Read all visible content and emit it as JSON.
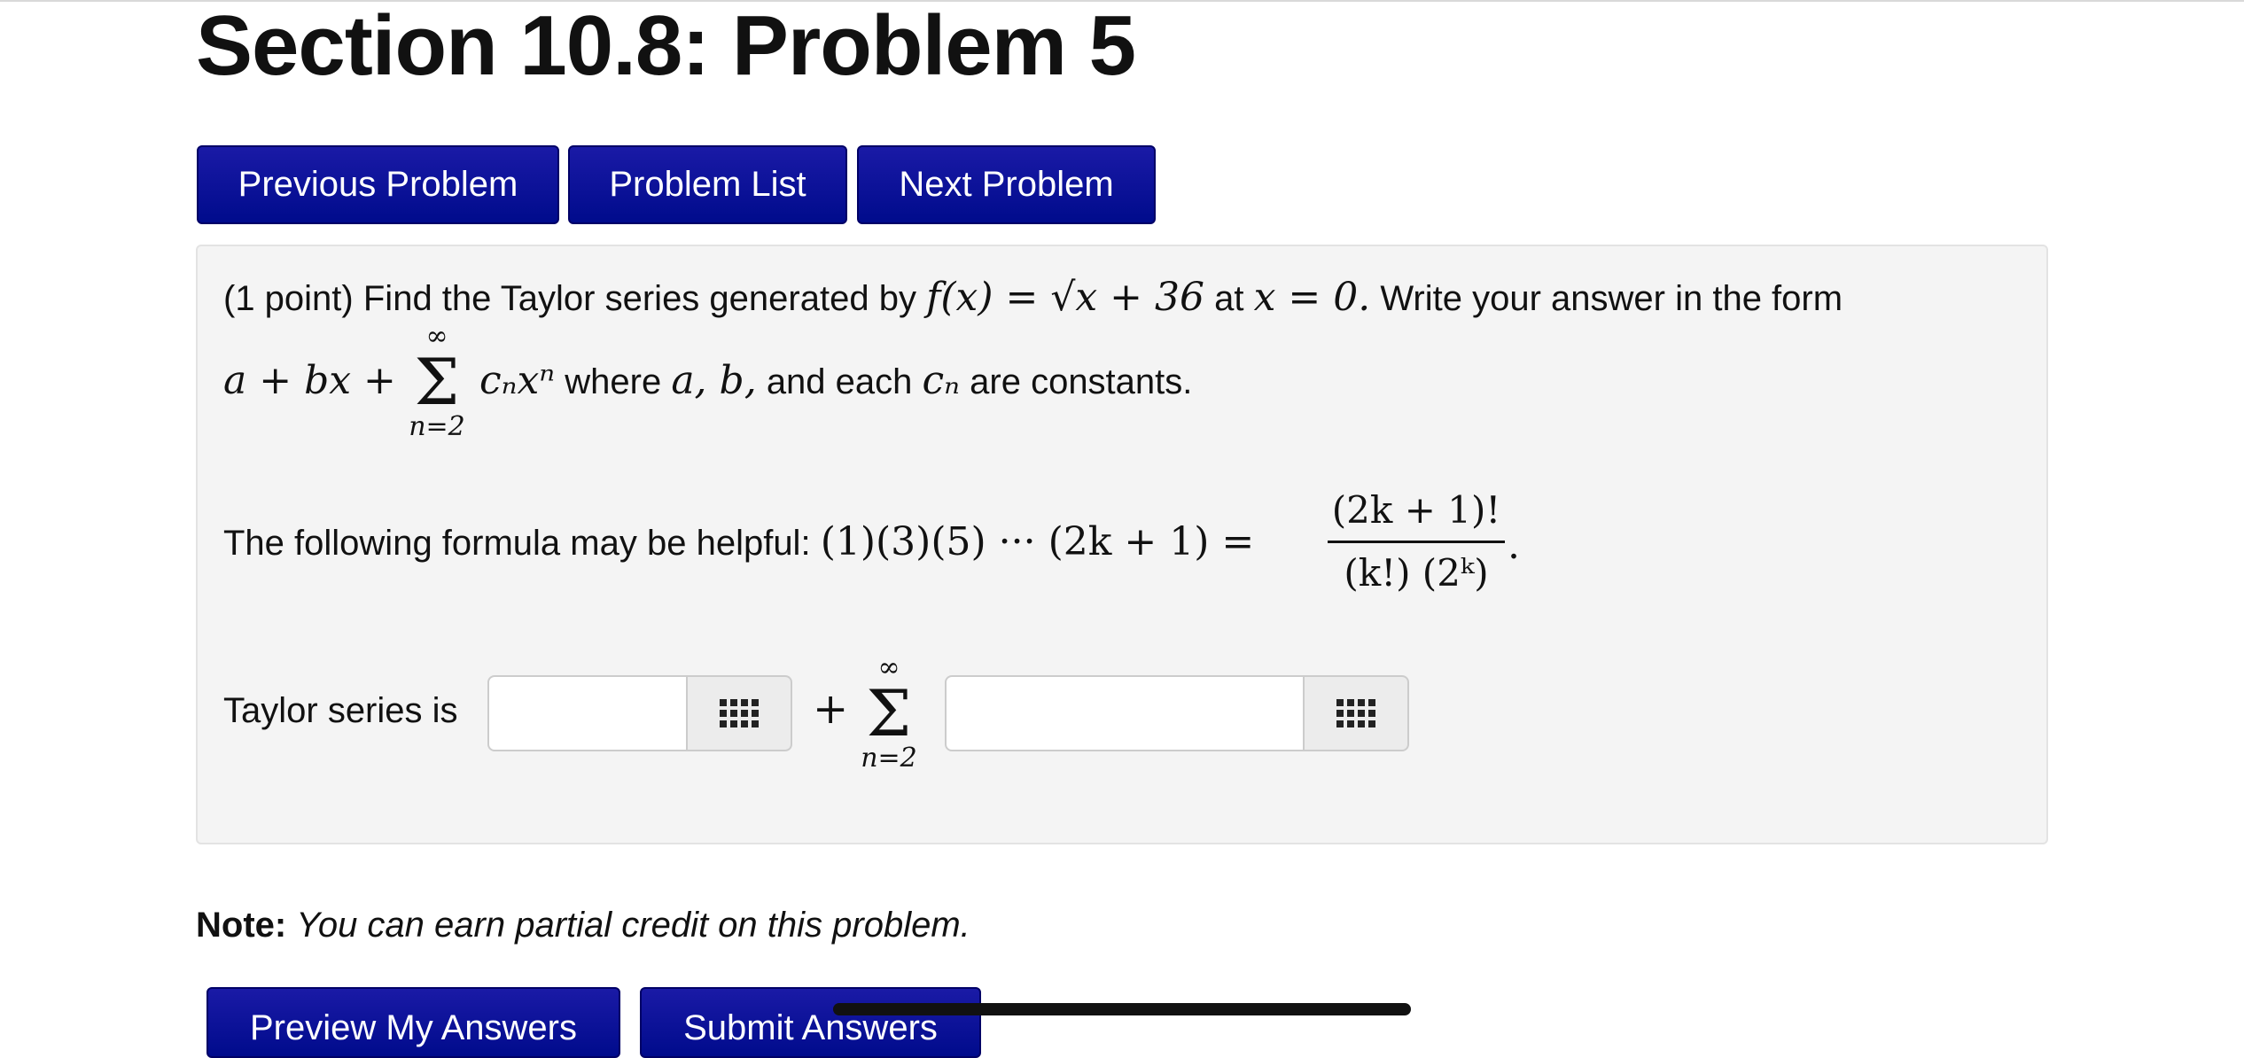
{
  "page": {
    "title": "Section 10.8: Problem 5"
  },
  "nav": {
    "previous_label": "Previous Problem",
    "list_label": "Problem List",
    "next_label": "Next Problem"
  },
  "problem": {
    "points": "(1 point)",
    "intro": "Find the Taylor series generated by",
    "function": "f(x) = √x + 36",
    "at_word": "at",
    "point": "x = 0.",
    "form_intro": "Write your answer in the form",
    "form_expr": "a + bx +",
    "sum_upper": "∞",
    "sum_symbol": "Σ",
    "sum_lower": "n=2",
    "sum_term": "cₙxⁿ",
    "where_text": "where",
    "constants_vars": "a, b,",
    "and_each": "and each",
    "cn": "cₙ",
    "are_constants": "are constants.",
    "helper_text": "The following formula may be helpful:",
    "helper_lhs": "(1)(3)(5) ··· (2k + 1) =",
    "helper_num": "(2k + 1)!",
    "helper_den": "(k!) (2ᵏ)",
    "helper_end": "."
  },
  "answer": {
    "label": "Taylor series is",
    "plus": "+",
    "sum_upper": "∞",
    "sum_symbol": "Σ",
    "sum_lower": "n=2",
    "input1_value": "",
    "input2_value": ""
  },
  "note": {
    "bold": "Note:",
    "text": "You can earn partial credit on this problem."
  },
  "actions": {
    "preview_label": "Preview My Answers",
    "submit_label": "Submit Answers"
  },
  "icons": {
    "palette_icon": "grid-icon"
  },
  "colors": {
    "button_blue": "#000b8c",
    "panel_bg": "#f4f4f4"
  }
}
